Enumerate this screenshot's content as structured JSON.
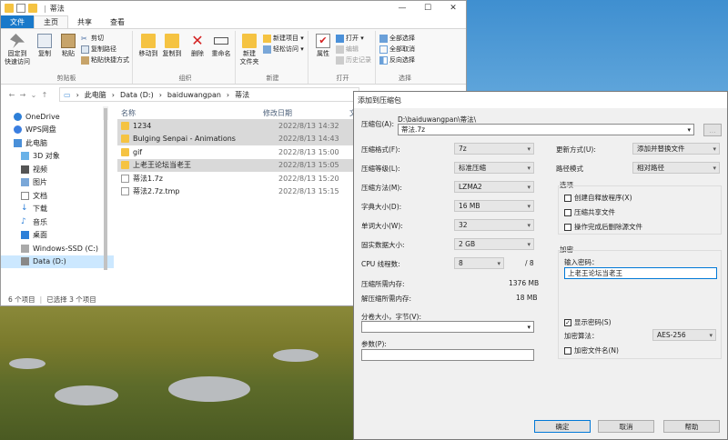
{
  "explorer": {
    "title": "蒂法",
    "tabs": [
      "文件",
      "主页",
      "共享",
      "查看"
    ],
    "ribbon": {
      "pin": "固定到\n快速访问",
      "copy": "复制",
      "paste": "粘贴",
      "cut": "剪切",
      "copy_path": "复制路径",
      "paste_shortcut": "粘贴快捷方式",
      "group_clipboard": "剪贴板",
      "move_to": "移动到",
      "copy_to": "复制到",
      "delete": "删除",
      "rename": "重命名",
      "group_organize": "组织",
      "new_folder": "新建\n文件夹",
      "new_item": "新建项目 ▾",
      "easy_access": "轻松访问 ▾",
      "group_new": "新建",
      "properties": "属性",
      "open": "打开 ▾",
      "edit": "编辑",
      "history": "历史记录",
      "group_open": "打开",
      "select_all": "全部选择",
      "select_none": "全部取消",
      "invert": "反向选择",
      "group_select": "选择"
    },
    "breadcrumb": [
      "此电脑",
      "Data (D:)",
      "baiduwangpan",
      "蒂法"
    ],
    "sidebar": [
      "OneDrive",
      "WPS网盘",
      "此电脑",
      "3D 对象",
      "视频",
      "图片",
      "文档",
      "下载",
      "音乐",
      "桌面",
      "Windows-SSD (C:)",
      "Data (D:)"
    ],
    "columns": {
      "name": "名称",
      "date": "修改日期",
      "type": "文"
    },
    "files": [
      {
        "name": "1234",
        "date": "2022/8/13 14:32",
        "type": "文",
        "kind": "folder",
        "selected": true
      },
      {
        "name": "Bulging Senpai - Animations",
        "date": "2022/8/13 14:43",
        "type": "文",
        "kind": "folder",
        "selected": true
      },
      {
        "name": "gif",
        "date": "2022/8/13 15:00",
        "type": "文",
        "kind": "folder",
        "selected": false
      },
      {
        "name": "上老王论坛当老王",
        "date": "2022/8/13 15:05",
        "type": "文",
        "kind": "folder",
        "selected": true
      },
      {
        "name": "蒂法1.7z",
        "date": "2022/8/13 15:20",
        "type": "H",
        "kind": "file",
        "selected": false
      },
      {
        "name": "蒂法2.7z.tmp",
        "date": "2022/8/13 15:15",
        "type": "T",
        "kind": "file",
        "selected": false
      }
    ],
    "status_items": "6 个项目",
    "status_selected": "已选择 3 个项目"
  },
  "dialog": {
    "title": "添加到压缩包",
    "archive_label": "压缩包(A):",
    "archive_path": "D:\\baiduwangpan\\蒂法\\",
    "archive_name": "蒂法.7z",
    "format_label": "压缩格式(F):",
    "format": "7z",
    "level_label": "压缩等级(L):",
    "level": "标准压缩",
    "method_label": "压缩方法(M):",
    "method": "LZMA2",
    "dict_label": "字典大小(D):",
    "dict": "16 MB",
    "word_label": "单词大小(W):",
    "word": "32",
    "solid_label": "固实数据大小:",
    "solid": "2 GB",
    "cpu_label": "CPU 线程数:",
    "cpu": "8",
    "cpu_total": "/ 8",
    "mem_c_label": "压缩所需内存:",
    "mem_c": "1376 MB",
    "mem_d_label": "解压缩所需内存:",
    "mem_d": "18 MB",
    "split_label": "分卷大小，字节(V):",
    "params_label": "参数(P):",
    "update_label": "更新方式(U):",
    "update": "添加并替换文件",
    "path_label": "路径模式",
    "path_mode": "相对路径",
    "options_label": "选项",
    "opt_sfx": "创建自释放程序(X)",
    "opt_shared": "压缩共享文件",
    "opt_delete": "操作完成后删除源文件",
    "enc_label": "加密",
    "pwd_label": "输入密码：",
    "pwd": "上老王论坛当老王",
    "show_pwd": "显示密码(S)",
    "enc_method_label": "加密算法：",
    "enc_method": "AES-256",
    "enc_names": "加密文件名(N)",
    "ok": "确定",
    "cancel": "取消",
    "help": "帮助"
  }
}
